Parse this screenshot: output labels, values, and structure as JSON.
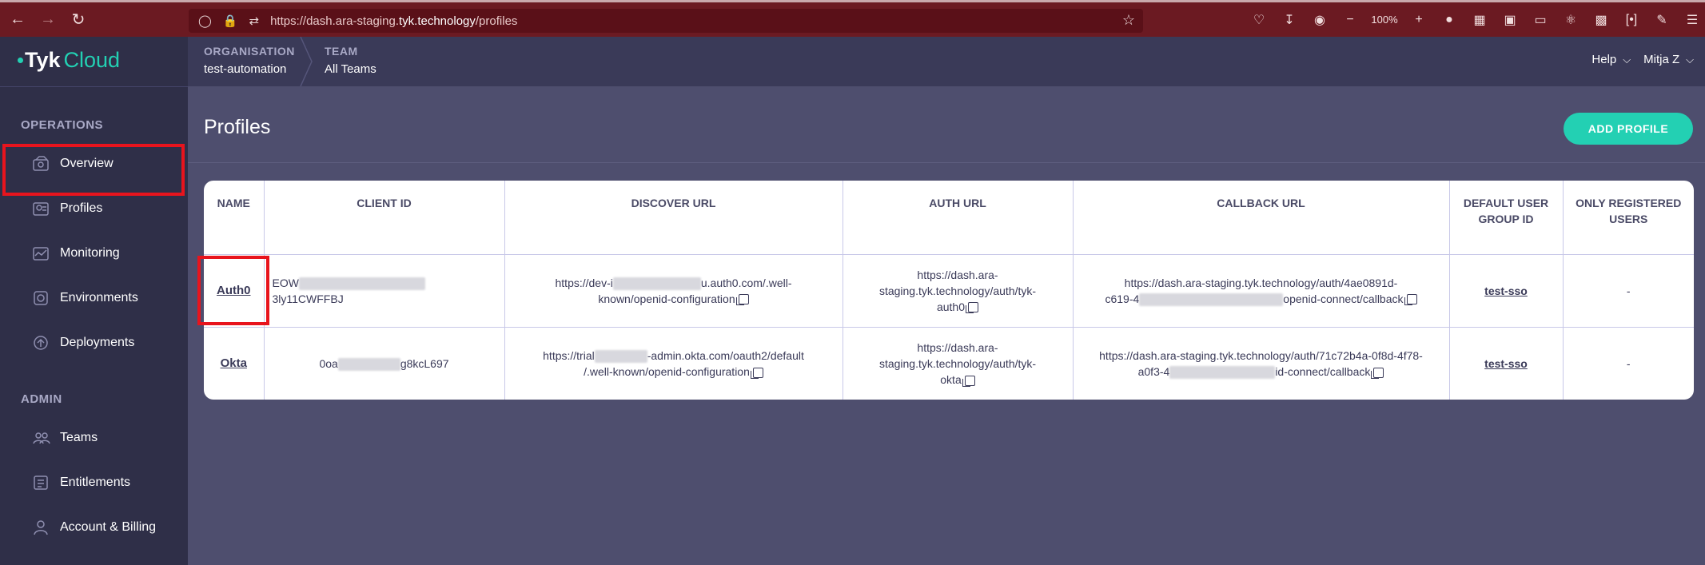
{
  "browser": {
    "url_prefix": "https://dash.ara-staging.",
    "url_host": "tyk.technology",
    "url_path": "/profiles",
    "zoom": "100%"
  },
  "brand": {
    "name": "Tyk",
    "product": "Cloud"
  },
  "sidebar": {
    "operations_label": "OPERATIONS",
    "admin_label": "ADMIN",
    "items": [
      {
        "label": "Overview"
      },
      {
        "label": "Profiles"
      },
      {
        "label": "Monitoring"
      },
      {
        "label": "Environments"
      },
      {
        "label": "Deployments"
      },
      {
        "label": "Teams"
      },
      {
        "label": "Entitlements"
      },
      {
        "label": "Account & Billing"
      }
    ]
  },
  "header": {
    "org_label": "ORGANISATION",
    "org_value": "test-automation",
    "team_label": "TEAM",
    "team_value": "All Teams",
    "help": "Help",
    "user": "Mitja Z"
  },
  "main": {
    "title": "Profiles",
    "add_button": "ADD PROFILE"
  },
  "table": {
    "headers": [
      "NAME",
      "CLIENT ID",
      "DISCOVER URL",
      "AUTH URL",
      "CALLBACK URL",
      "DEFAULT USER GROUP ID",
      "ONLY REGISTERED USERS"
    ],
    "rows": [
      {
        "name": "Auth0",
        "client_id_a": "EOW",
        "client_id_b": "3ly11CWFFBJ",
        "discover_a": "https://dev-i",
        "discover_b": "u.auth0.com/.well-",
        "discover_c": "known/openid-configuration",
        "auth_a": "https://dash.ara-",
        "auth_b": "staging.tyk.technology/auth/tyk-",
        "auth_c": "auth0",
        "callback_a": "https://dash.ara-staging.tyk.technology/auth/4ae0891d-",
        "callback_b": "c619-4",
        "callback_c": "openid-connect/callback",
        "group": "test-sso",
        "registered": "-"
      },
      {
        "name": "Okta",
        "client_id_a": "0oa",
        "client_id_b": "g8kcL697",
        "discover_a": "https://trial",
        "discover_b": "-admin.okta.com/oauth2/default",
        "discover_c": "/.well-known/openid-configuration",
        "auth_a": "https://dash.ara-",
        "auth_b": "staging.tyk.technology/auth/tyk-",
        "auth_c": "okta",
        "callback_a": "https://dash.ara-staging.tyk.technology/auth/71c72b4a-0f8d-4f78-",
        "callback_b": "a0f3-4",
        "callback_c": "id-connect/callback",
        "group": "test-sso",
        "registered": "-"
      }
    ]
  },
  "colors": {
    "accent": "#23d0b3",
    "highlight": "#e8141d",
    "sidebar": "#2f2f48"
  }
}
